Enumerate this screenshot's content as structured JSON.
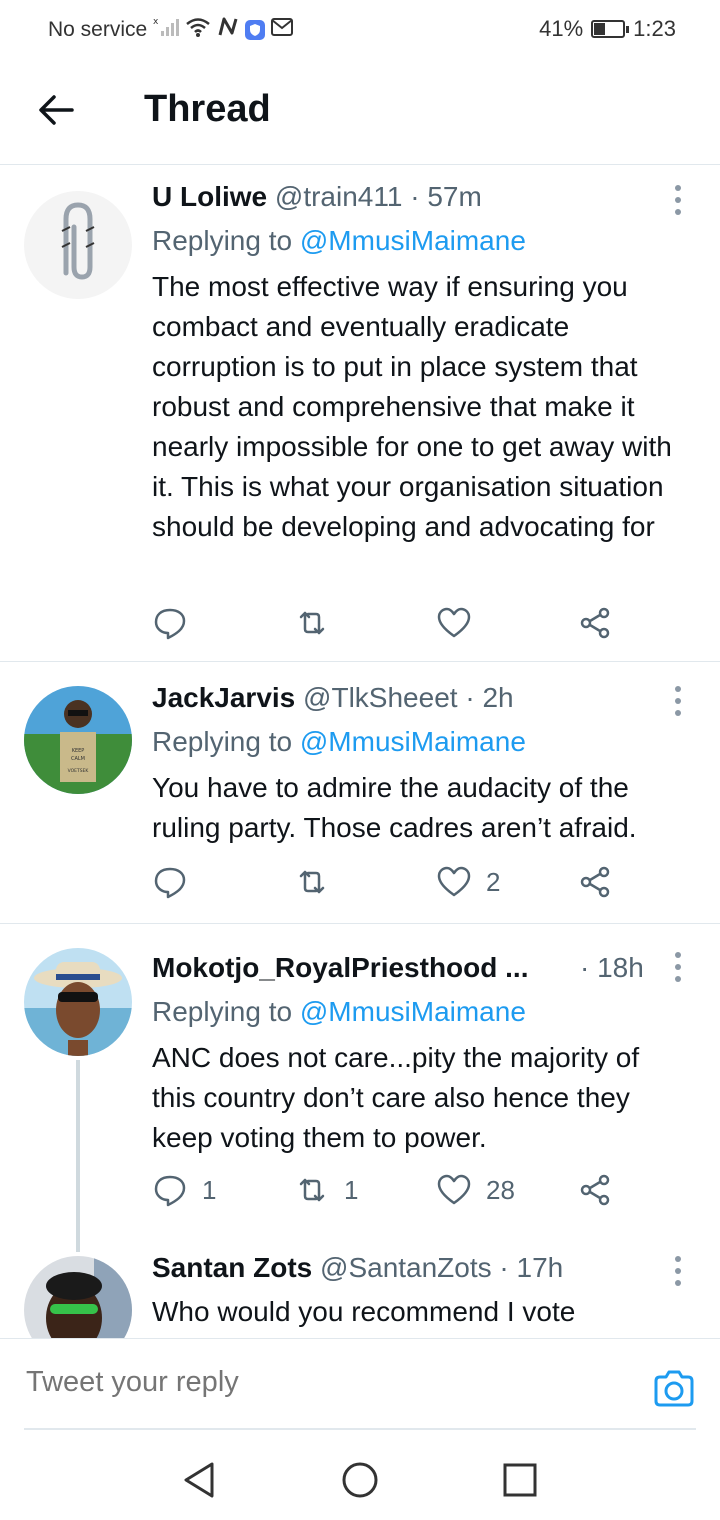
{
  "status_bar": {
    "carrier": "No service",
    "battery_percent": "41%",
    "battery_level": 0.41,
    "time": "1:23"
  },
  "header": {
    "title": "Thread"
  },
  "tweets": [
    {
      "name": "U Loliwe",
      "handle": "@train411",
      "time": "57m",
      "replying_label": "Replying to",
      "replying_to": "@MmusiMaimane",
      "text": "The most effective way if ensuring you combact and eventually eradicate corruption is to put in place system that robust and comprehensive that make it nearly impossible for one to get away with it. This is what your organisation situation should be developing and advocating for",
      "replies": "",
      "retweets": "",
      "likes": ""
    },
    {
      "name": "JackJarvis",
      "handle": "@TlkSheeet",
      "time": "2h",
      "replying_label": "Replying to",
      "replying_to": "@MmusiMaimane",
      "text": "You have to admire the audacity of the ruling party. Those cadres aren’t afraid.",
      "avatar_text": [
        "KEEP",
        "CALM",
        "VOETSEK"
      ],
      "replies": "",
      "retweets": "",
      "likes": "2"
    },
    {
      "name": "Mokotjo_RoyalPriesthood ...",
      "handle": "",
      "time": "18h",
      "replying_label": "Replying to",
      "replying_to": "@MmusiMaimane",
      "text": "ANC does not care...pity the majority of this country don’t care also hence they keep voting them to power.",
      "replies": "1",
      "retweets": "1",
      "likes": "28"
    },
    {
      "name": "Santan Zots",
      "handle": "@SantanZots",
      "time": "17h",
      "text": "Who would you recommend I vote"
    }
  ],
  "reply_bar": {
    "placeholder": "Tweet your reply"
  },
  "icons": {
    "back": "arrow-left-icon",
    "more": "more-vertical-icon",
    "reply": "speech-bubble-icon",
    "retweet": "retweet-icon",
    "like": "heart-icon",
    "share": "share-icon",
    "camera": "camera-icon"
  },
  "colors": {
    "accent": "#1d9bf0",
    "secondary_text": "#536471",
    "divider": "#e1e8ed"
  }
}
